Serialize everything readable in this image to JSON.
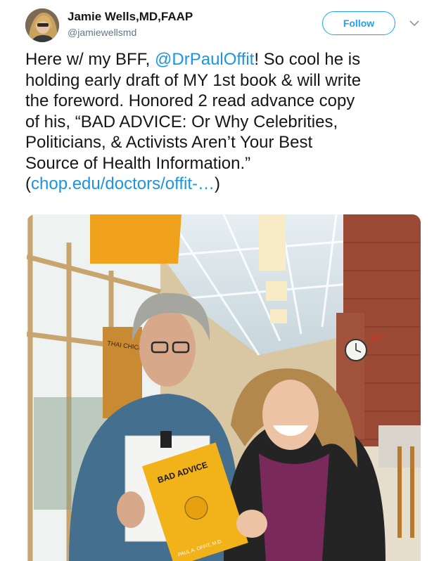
{
  "author": {
    "display_name": "Jamie Wells,MD,FAAP",
    "handle": "@jamiewellsmd"
  },
  "follow_label": "Follow",
  "tweet": {
    "line1_pre": "Here w/ my BFF, ",
    "mention": "@DrPaulOffit",
    "line1_post": "! So cool he is",
    "line2": "holding early draft of MY 1st book & will write",
    "line3": "the foreword. Honored 2 read advance copy",
    "line4": "of his, “BAD ADVICE: Or Why Celebrities,",
    "line5": "Politicians, & Activists Aren’t Your Best",
    "line6": "Source of Health Information.”",
    "link_open": "(",
    "link": "chop.edu/doctors/offit-…",
    "link_close": ")"
  },
  "photo": {
    "book_title": "BAD ADVICE",
    "book_author": "PAUL A. OFFIT, M.D.",
    "poster_text": "THAI CHICKEN & LIME",
    "exit_sign": "EXIT"
  }
}
